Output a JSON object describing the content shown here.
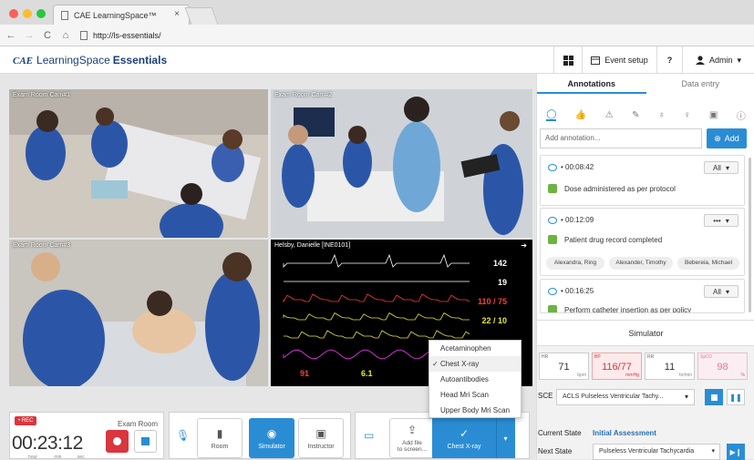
{
  "browser": {
    "tab_title": "CAE LearningSpace™",
    "tab_close": "×",
    "url": "http://ls-essentials/",
    "nav": {
      "back": "←",
      "forward": "→",
      "reload": "C",
      "home": "⌂"
    },
    "colors": {
      "close": "#fc5f57",
      "minimize": "#fdbc2e",
      "maximize": "#28c840"
    }
  },
  "header": {
    "logo_cae": "CAE",
    "logo_learningspace": "LearningSpace",
    "logo_essentials": "Essentials",
    "event_setup": "Event setup",
    "help": "?",
    "user": "Admin",
    "user_caret": "▾"
  },
  "cameras": [
    {
      "label": "Exam Room Cam#1"
    },
    {
      "label": "Exam Room Cam#2"
    },
    {
      "label": "Exam Room Cam#3"
    }
  ],
  "monitor": {
    "patient": "Helsby, Danielle [INE0101]",
    "values": [
      "142",
      "19",
      "110 / 75",
      "22 / 10",
      "91",
      "6.1"
    ],
    "value_colors": [
      "#ffffff",
      "#ffffff",
      "#ff3b3b",
      "#e8e832",
      "#ff3b3b",
      "#e8e832"
    ],
    "wave_colors": [
      "#ffffff",
      "#ffffff",
      "#ff3b3b",
      "#e8e832",
      "#e8e832",
      "#ff3bff"
    ]
  },
  "dropdown": {
    "options": [
      "Acetaminophen",
      "Chest X-ray",
      "Autoantibodies",
      "Head Mri Scan",
      "Upper Body  Mri Scan"
    ],
    "selected": "Chest X-ray",
    "check": "✓"
  },
  "recording": {
    "rec_label": "• REC",
    "room": "Exam Room",
    "time_hh": "00",
    "time_mm": "23",
    "time_ss": "12",
    "units": [
      "hour",
      "min",
      "sec"
    ]
  },
  "controls": {
    "room": "Room",
    "simulator": "Simulator",
    "instructor": "Instructor"
  },
  "file": {
    "add_file": "Add file\nto screen...",
    "chest_xray": "Chest X-ray"
  },
  "annotations_panel": {
    "tab_annotations": "Annotations",
    "tab_data_entry": "Data entry",
    "placeholder": "Add annotation...",
    "add_button": "Add",
    "items": [
      {
        "time": "• 00:08:42",
        "selector": "All",
        "text": "Dose administered as per protocol",
        "people": []
      },
      {
        "time": "• 00:12:09",
        "selector": "•••",
        "text": "Patient drug record completed",
        "people": [
          "Alexandra, Ring",
          "Alexander, Timothy",
          "Bebereia, Michael"
        ]
      },
      {
        "time": "• 00:16:25",
        "selector": "All",
        "text": "Perform catheter insertion as per policy",
        "people": []
      }
    ]
  },
  "simulator": {
    "title": "Simulator",
    "vitals": [
      {
        "label": "HR",
        "value": "71",
        "unit": "bpm"
      },
      {
        "label": "BP",
        "value": "116/77",
        "unit": "mmHg"
      },
      {
        "label": "RR",
        "value": "11",
        "unit": "br/min"
      },
      {
        "label": "SpO2",
        "value": "98",
        "unit": "%"
      }
    ],
    "sce_label": "SCE",
    "sce_value": "ACLS Pulseless Ventricular Tachy...",
    "current_state_label": "Current State",
    "current_state_value": "Initial Assessment",
    "next_state_label": "Next State",
    "next_state_value": "Pulseless Ventricular Tachycardia"
  }
}
